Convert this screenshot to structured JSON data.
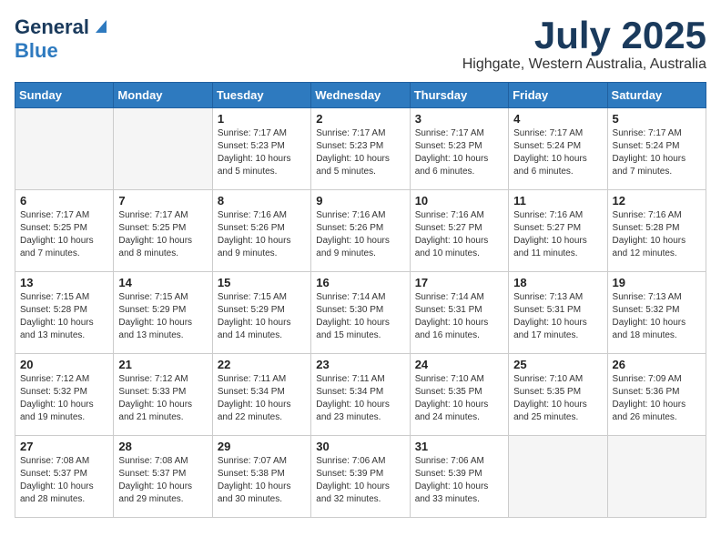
{
  "header": {
    "logo_general": "General",
    "logo_blue": "Blue",
    "month_title": "July 2025",
    "location": "Highgate, Western Australia, Australia"
  },
  "weekdays": [
    "Sunday",
    "Monday",
    "Tuesday",
    "Wednesday",
    "Thursday",
    "Friday",
    "Saturday"
  ],
  "weeks": [
    [
      {
        "day": "",
        "empty": true
      },
      {
        "day": "",
        "empty": true
      },
      {
        "day": "1",
        "sunrise": "Sunrise: 7:17 AM",
        "sunset": "Sunset: 5:23 PM",
        "daylight": "Daylight: 10 hours and 5 minutes."
      },
      {
        "day": "2",
        "sunrise": "Sunrise: 7:17 AM",
        "sunset": "Sunset: 5:23 PM",
        "daylight": "Daylight: 10 hours and 5 minutes."
      },
      {
        "day": "3",
        "sunrise": "Sunrise: 7:17 AM",
        "sunset": "Sunset: 5:23 PM",
        "daylight": "Daylight: 10 hours and 6 minutes."
      },
      {
        "day": "4",
        "sunrise": "Sunrise: 7:17 AM",
        "sunset": "Sunset: 5:24 PM",
        "daylight": "Daylight: 10 hours and 6 minutes."
      },
      {
        "day": "5",
        "sunrise": "Sunrise: 7:17 AM",
        "sunset": "Sunset: 5:24 PM",
        "daylight": "Daylight: 10 hours and 7 minutes."
      }
    ],
    [
      {
        "day": "6",
        "sunrise": "Sunrise: 7:17 AM",
        "sunset": "Sunset: 5:25 PM",
        "daylight": "Daylight: 10 hours and 7 minutes."
      },
      {
        "day": "7",
        "sunrise": "Sunrise: 7:17 AM",
        "sunset": "Sunset: 5:25 PM",
        "daylight": "Daylight: 10 hours and 8 minutes."
      },
      {
        "day": "8",
        "sunrise": "Sunrise: 7:16 AM",
        "sunset": "Sunset: 5:26 PM",
        "daylight": "Daylight: 10 hours and 9 minutes."
      },
      {
        "day": "9",
        "sunrise": "Sunrise: 7:16 AM",
        "sunset": "Sunset: 5:26 PM",
        "daylight": "Daylight: 10 hours and 9 minutes."
      },
      {
        "day": "10",
        "sunrise": "Sunrise: 7:16 AM",
        "sunset": "Sunset: 5:27 PM",
        "daylight": "Daylight: 10 hours and 10 minutes."
      },
      {
        "day": "11",
        "sunrise": "Sunrise: 7:16 AM",
        "sunset": "Sunset: 5:27 PM",
        "daylight": "Daylight: 10 hours and 11 minutes."
      },
      {
        "day": "12",
        "sunrise": "Sunrise: 7:16 AM",
        "sunset": "Sunset: 5:28 PM",
        "daylight": "Daylight: 10 hours and 12 minutes."
      }
    ],
    [
      {
        "day": "13",
        "sunrise": "Sunrise: 7:15 AM",
        "sunset": "Sunset: 5:28 PM",
        "daylight": "Daylight: 10 hours and 13 minutes."
      },
      {
        "day": "14",
        "sunrise": "Sunrise: 7:15 AM",
        "sunset": "Sunset: 5:29 PM",
        "daylight": "Daylight: 10 hours and 13 minutes."
      },
      {
        "day": "15",
        "sunrise": "Sunrise: 7:15 AM",
        "sunset": "Sunset: 5:29 PM",
        "daylight": "Daylight: 10 hours and 14 minutes."
      },
      {
        "day": "16",
        "sunrise": "Sunrise: 7:14 AM",
        "sunset": "Sunset: 5:30 PM",
        "daylight": "Daylight: 10 hours and 15 minutes."
      },
      {
        "day": "17",
        "sunrise": "Sunrise: 7:14 AM",
        "sunset": "Sunset: 5:31 PM",
        "daylight": "Daylight: 10 hours and 16 minutes."
      },
      {
        "day": "18",
        "sunrise": "Sunrise: 7:13 AM",
        "sunset": "Sunset: 5:31 PM",
        "daylight": "Daylight: 10 hours and 17 minutes."
      },
      {
        "day": "19",
        "sunrise": "Sunrise: 7:13 AM",
        "sunset": "Sunset: 5:32 PM",
        "daylight": "Daylight: 10 hours and 18 minutes."
      }
    ],
    [
      {
        "day": "20",
        "sunrise": "Sunrise: 7:12 AM",
        "sunset": "Sunset: 5:32 PM",
        "daylight": "Daylight: 10 hours and 19 minutes."
      },
      {
        "day": "21",
        "sunrise": "Sunrise: 7:12 AM",
        "sunset": "Sunset: 5:33 PM",
        "daylight": "Daylight: 10 hours and 21 minutes."
      },
      {
        "day": "22",
        "sunrise": "Sunrise: 7:11 AM",
        "sunset": "Sunset: 5:34 PM",
        "daylight": "Daylight: 10 hours and 22 minutes."
      },
      {
        "day": "23",
        "sunrise": "Sunrise: 7:11 AM",
        "sunset": "Sunset: 5:34 PM",
        "daylight": "Daylight: 10 hours and 23 minutes."
      },
      {
        "day": "24",
        "sunrise": "Sunrise: 7:10 AM",
        "sunset": "Sunset: 5:35 PM",
        "daylight": "Daylight: 10 hours and 24 minutes."
      },
      {
        "day": "25",
        "sunrise": "Sunrise: 7:10 AM",
        "sunset": "Sunset: 5:35 PM",
        "daylight": "Daylight: 10 hours and 25 minutes."
      },
      {
        "day": "26",
        "sunrise": "Sunrise: 7:09 AM",
        "sunset": "Sunset: 5:36 PM",
        "daylight": "Daylight: 10 hours and 26 minutes."
      }
    ],
    [
      {
        "day": "27",
        "sunrise": "Sunrise: 7:08 AM",
        "sunset": "Sunset: 5:37 PM",
        "daylight": "Daylight: 10 hours and 28 minutes."
      },
      {
        "day": "28",
        "sunrise": "Sunrise: 7:08 AM",
        "sunset": "Sunset: 5:37 PM",
        "daylight": "Daylight: 10 hours and 29 minutes."
      },
      {
        "day": "29",
        "sunrise": "Sunrise: 7:07 AM",
        "sunset": "Sunset: 5:38 PM",
        "daylight": "Daylight: 10 hours and 30 minutes."
      },
      {
        "day": "30",
        "sunrise": "Sunrise: 7:06 AM",
        "sunset": "Sunset: 5:39 PM",
        "daylight": "Daylight: 10 hours and 32 minutes."
      },
      {
        "day": "31",
        "sunrise": "Sunrise: 7:06 AM",
        "sunset": "Sunset: 5:39 PM",
        "daylight": "Daylight: 10 hours and 33 minutes."
      },
      {
        "day": "",
        "empty": true
      },
      {
        "day": "",
        "empty": true
      }
    ]
  ]
}
